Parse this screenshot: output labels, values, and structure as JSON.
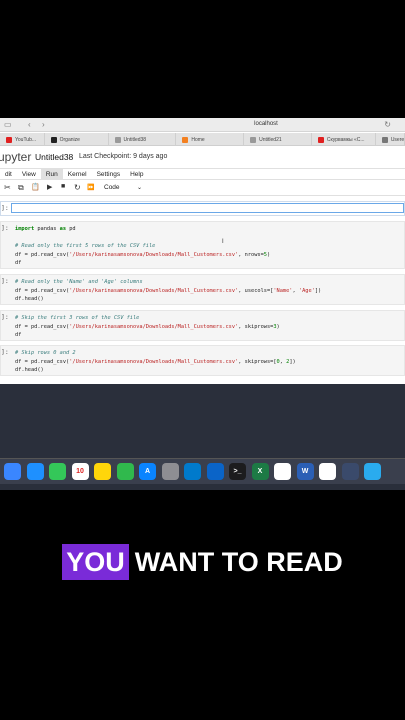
{
  "browser": {
    "back": "‹",
    "forward": "›",
    "url": "localhost",
    "reload": "↻",
    "tabs": [
      {
        "label": "YouTub...",
        "color": "#e02020"
      },
      {
        "label": "Organize",
        "color": "#222222"
      },
      {
        "label": "Untitled38",
        "color": "#999999"
      },
      {
        "label": "Home",
        "color": "#f38020"
      },
      {
        "label": "Untitled21",
        "color": "#999999"
      },
      {
        "label": "Скурвамкы «С...",
        "color": "#e02020"
      },
      {
        "label": "Useren",
        "color": "#777777"
      }
    ]
  },
  "jupyter": {
    "logo": "upyter",
    "notebook_title": "Untitled38",
    "checkpoint": "Last Checkpoint: 9 days ago",
    "menus": [
      "dit",
      "View",
      "Run",
      "Kernel",
      "Settings",
      "Help"
    ],
    "active_menu": "Run",
    "toolbar": {
      "cut": "✂",
      "copy": "⧉",
      "paste": "📋",
      "run": "▶",
      "stop": "■",
      "restart": "↻",
      "fastforward": "⏩",
      "cell_type": "Code",
      "cell_type_caret": "⌄"
    }
  },
  "cells": [
    {
      "prompt": "]:",
      "lines": []
    },
    {
      "prompt": "]:",
      "lines": [
        "import pandas as pd",
        "",
        "# Read only the first 5 rows of the CSV file",
        "df = pd.read_csv('/Users/karinasamsonova/Downloads/Mall_Customers.csv', nrows=5)",
        "df"
      ]
    },
    {
      "prompt": "]:",
      "lines": [
        "# Read only the 'Name' and 'Age' columns",
        "df = pd.read_csv('/Users/karinasamsonova/Downloads/Mall_Customers.csv', usecols=['Name', 'Age'])",
        "df.head()"
      ]
    },
    {
      "prompt": "]:",
      "lines": [
        "# Skip the first 3 rows of the CSV file",
        "df = pd.read_csv('/Users/karinasamsonova/Downloads/Mall_Customers.csv', skiprows=3)",
        "df"
      ]
    },
    {
      "prompt": "]:",
      "lines": [
        "# Skip rows 0 and 2",
        "df = pd.read_csv('/Users/karinasamsonova/Downloads/Mall_Customers.csv', skiprows=[0, 2])",
        "df.head()"
      ]
    }
  ],
  "dock": [
    {
      "name": "finder",
      "color": "#3a86ff",
      "glyph": ""
    },
    {
      "name": "safari",
      "color": "#1e90ff",
      "glyph": ""
    },
    {
      "name": "messages",
      "color": "#34c759",
      "glyph": ""
    },
    {
      "name": "calendar",
      "color": "#ffffff",
      "glyph": "10"
    },
    {
      "name": "notes",
      "color": "#ffd60a",
      "glyph": ""
    },
    {
      "name": "numbers",
      "color": "#30b94d",
      "glyph": ""
    },
    {
      "name": "appstore",
      "color": "#0a84ff",
      "glyph": "A"
    },
    {
      "name": "settings",
      "color": "#8e8e93",
      "glyph": ""
    },
    {
      "name": "vscode",
      "color": "#007acc",
      "glyph": ""
    },
    {
      "name": "outlook",
      "color": "#0a64c8",
      "glyph": ""
    },
    {
      "name": "terminal",
      "color": "#1c1c1e",
      "glyph": ">_"
    },
    {
      "name": "excel",
      "color": "#1d7a45",
      "glyph": "X"
    },
    {
      "name": "capcut",
      "color": "#ffffff",
      "glyph": ""
    },
    {
      "name": "word",
      "color": "#2b5fb5",
      "glyph": "W"
    },
    {
      "name": "chatgpt",
      "color": "#ffffff",
      "glyph": ""
    },
    {
      "name": "anaconda",
      "color": "#3a4a6b",
      "glyph": ""
    },
    {
      "name": "telegram",
      "color": "#2aabee",
      "glyph": ""
    }
  ],
  "caption": {
    "highlight": "YOU",
    "rest": "WANT TO READ"
  }
}
